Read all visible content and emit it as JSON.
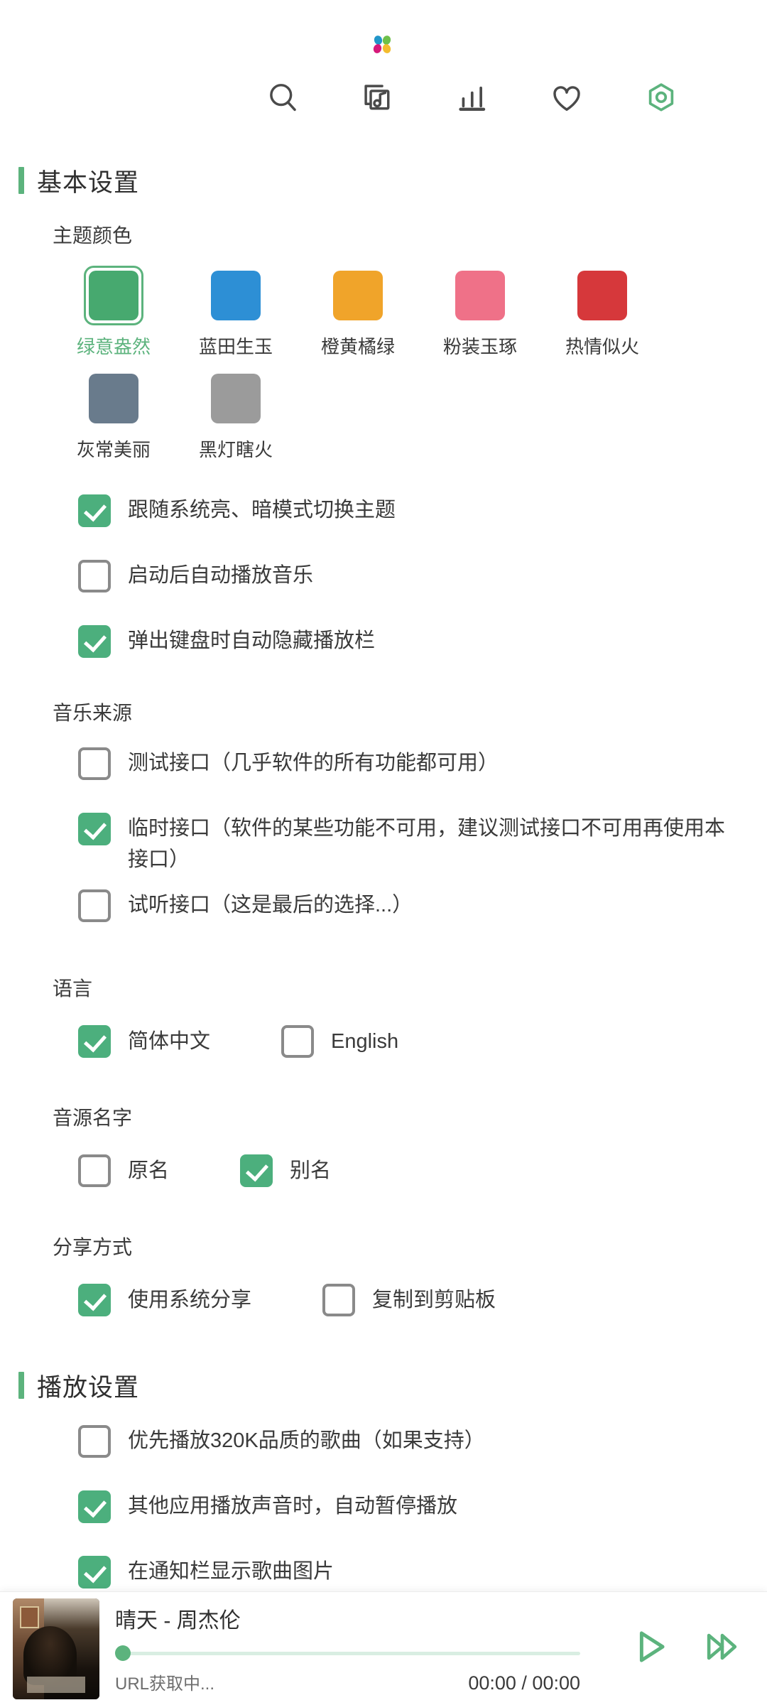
{
  "app": {
    "logo_name": "app-logo",
    "accent_color": "#5cb37d",
    "checkbox_on_color": "#4caf7d",
    "checkbox_off_color": "#8a8a8a"
  },
  "nav": {
    "items": [
      {
        "icon": "search-icon",
        "name": "nav-search"
      },
      {
        "icon": "playlist-music-icon",
        "name": "nav-playlist"
      },
      {
        "icon": "chart-bars-icon",
        "name": "nav-leaderboard"
      },
      {
        "icon": "heart-icon",
        "name": "nav-favorites"
      },
      {
        "icon": "settings-hex-icon",
        "name": "nav-settings",
        "active": true
      }
    ]
  },
  "sections": {
    "basic": {
      "title": "基本设置",
      "theme": {
        "group_title": "主题颜色",
        "swatches": [
          {
            "label": "绿意盎然",
            "color": "#47a96f",
            "selected": true
          },
          {
            "label": "蓝田生玉",
            "color": "#2d8fd5",
            "selected": false
          },
          {
            "label": "橙黄橘绿",
            "color": "#f0a42a",
            "selected": false
          },
          {
            "label": "粉装玉琢",
            "color": "#ef7188",
            "selected": false
          },
          {
            "label": "热情似火",
            "color": "#d6383b",
            "selected": false
          },
          {
            "label": "灰常美丽",
            "color": "#697b8c",
            "selected": false
          },
          {
            "label": "黑灯瞎火",
            "color": "#9b9b9b",
            "selected": false
          }
        ]
      },
      "options": [
        {
          "label": "跟随系统亮、暗模式切换主题",
          "checked": true
        },
        {
          "label": "启动后自动播放音乐",
          "checked": false
        },
        {
          "label": "弹出键盘时自动隐藏播放栏",
          "checked": true
        }
      ],
      "source": {
        "group_title": "音乐来源",
        "options": [
          {
            "label": "测试接口（几乎软件的所有功能都可用）",
            "checked": false
          },
          {
            "label": "临时接口（软件的某些功能不可用，建议测试接口不可用再使用本接口）",
            "checked": true
          },
          {
            "label": "试听接口（这是最后的选择...）",
            "checked": false
          }
        ]
      },
      "language": {
        "group_title": "语言",
        "options": [
          {
            "label": "简体中文",
            "checked": true
          },
          {
            "label": "English",
            "checked": false
          }
        ]
      },
      "source_name": {
        "group_title": "音源名字",
        "options": [
          {
            "label": "原名",
            "checked": false
          },
          {
            "label": "别名",
            "checked": true
          }
        ]
      },
      "share": {
        "group_title": "分享方式",
        "options": [
          {
            "label": "使用系统分享",
            "checked": true
          },
          {
            "label": "复制到剪贴板",
            "checked": false
          }
        ]
      }
    },
    "playback": {
      "title": "播放设置",
      "options": [
        {
          "label": "优先播放320K品质的歌曲（如果支持）",
          "checked": false
        },
        {
          "label": "其他应用播放声音时，自动暂停播放",
          "checked": true
        },
        {
          "label": "在通知栏显示歌曲图片",
          "checked": true
        }
      ]
    }
  },
  "player": {
    "cover_name": "album-cover",
    "track": "晴天 - 周杰伦",
    "status": "URL获取中...",
    "time": "00:00 / 00:00",
    "progress_percent": 0,
    "play_label": "play-icon",
    "next_label": "next-icon"
  }
}
